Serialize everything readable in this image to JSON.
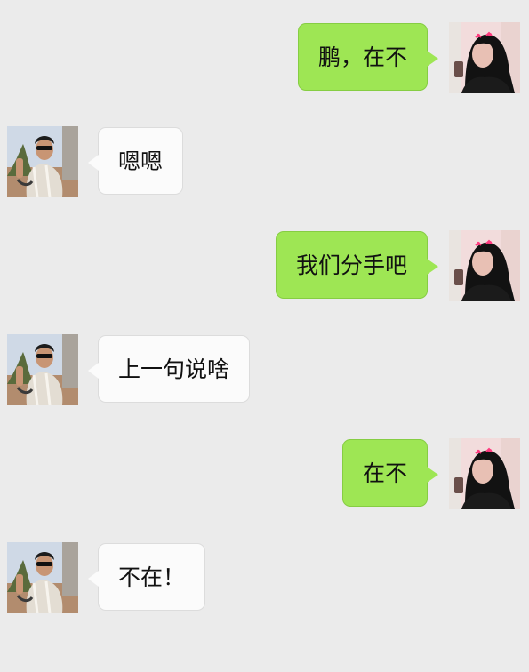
{
  "chat": {
    "messages": [
      {
        "sender": "me",
        "text": "鹏，在不",
        "avatar": "girl-avatar"
      },
      {
        "sender": "other",
        "text": "嗯嗯",
        "avatar": "boy-avatar"
      },
      {
        "sender": "me",
        "text": "我们分手吧",
        "avatar": "girl-avatar"
      },
      {
        "sender": "other",
        "text": "上一句说啥",
        "avatar": "boy-avatar"
      },
      {
        "sender": "me",
        "text": "在不",
        "avatar": "girl-avatar"
      },
      {
        "sender": "other",
        "text": "不在！",
        "avatar": "boy-avatar"
      }
    ]
  },
  "colors": {
    "background": "#ebebeb",
    "outgoing_bubble": "#9ee654",
    "incoming_bubble": "#fbfbfb"
  }
}
